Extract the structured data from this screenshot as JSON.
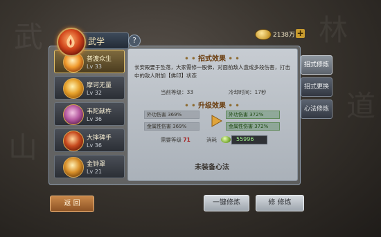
{
  "header": {
    "title": "武学",
    "help": "?",
    "currency": {
      "value": "2138万",
      "plus": "+"
    }
  },
  "skills": [
    {
      "name": "普渡众生",
      "level": "Lv 33",
      "active": true
    },
    {
      "name": "摩诃无量",
      "level": "Lv 32",
      "active": false
    },
    {
      "name": "韦陀献杵",
      "level": "Lv 36",
      "active": false
    },
    {
      "name": "大摔碑手",
      "level": "Lv 36",
      "active": false
    },
    {
      "name": "金钟罩",
      "level": "Lv 21",
      "active": false
    }
  ],
  "effect": {
    "heading": "招式效果",
    "description": "长安殿要于坠落，大家需修一股佛，对面前敌人造成多段伤害，打击中的敌人附加【佛印】状态",
    "current_level_label": "当前等级：33",
    "cooldown_label": "冷却时间：17秒"
  },
  "upgrade": {
    "heading": "升级效果",
    "current": [
      "外功伤害 369%",
      "金属性伤害 369%"
    ],
    "next": [
      "外功伤害 372%",
      "金属性伤害 372%"
    ],
    "need_level_label": "需要等级",
    "need_level_value": "71",
    "cost_label": "消耗",
    "cost_value": "55996"
  },
  "mind_method": "未装备心法",
  "tabs": [
    "招式修炼",
    "招式更换",
    "心法修炼"
  ],
  "buttons": {
    "back": "返 回",
    "one_click": "一键修炼",
    "train": "修 修炼"
  }
}
